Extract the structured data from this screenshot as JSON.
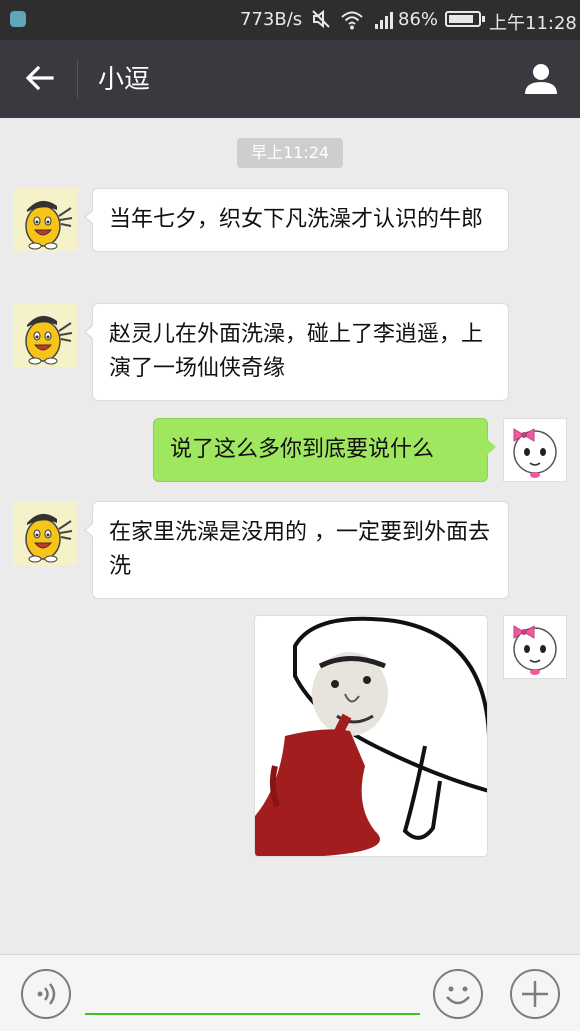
{
  "status_bar": {
    "speed": "773B/s",
    "battery_percent": "86%",
    "time": "上午11:28",
    "icons": [
      "app-notification-icon",
      "mute-icon",
      "wifi-icon",
      "signal-icon",
      "battery-icon"
    ]
  },
  "header": {
    "back_icon": "back-arrow-icon",
    "title": "小逗",
    "profile_icon": "person-icon"
  },
  "chat": {
    "timestamp": "早上11:24",
    "messages": [
      {
        "side": "left",
        "avatar": "yellow-bean-avatar",
        "text": "当年七夕，织女下凡洗澡才认识的牛郎"
      },
      {
        "side": "left",
        "avatar": "yellow-bean-avatar",
        "text": "赵灵儿在外面洗澡，碰上了李逍遥，上演了一场仙侠奇缘"
      },
      {
        "side": "right",
        "avatar": "white-bow-avatar",
        "text": "说了这么多你到底要说什么"
      },
      {
        "side": "left",
        "avatar": "yellow-bean-avatar",
        "text": "在家里洗澡是没用的 ，一定要到外面去洗"
      },
      {
        "side": "right",
        "avatar": "white-bow-avatar",
        "type": "sticker",
        "sticker": "nosebleed-meme-sticker"
      }
    ]
  },
  "input_bar": {
    "voice_icon": "voice-icon",
    "input_value": "",
    "emoji_icon": "emoji-icon",
    "plus_icon": "plus-icon"
  },
  "colors": {
    "header_bg": "#393a3f",
    "chat_bg": "#ebebeb",
    "sent_bubble": "#9fe75e",
    "received_bubble": "#ffffff",
    "input_underline": "#45c01a"
  }
}
